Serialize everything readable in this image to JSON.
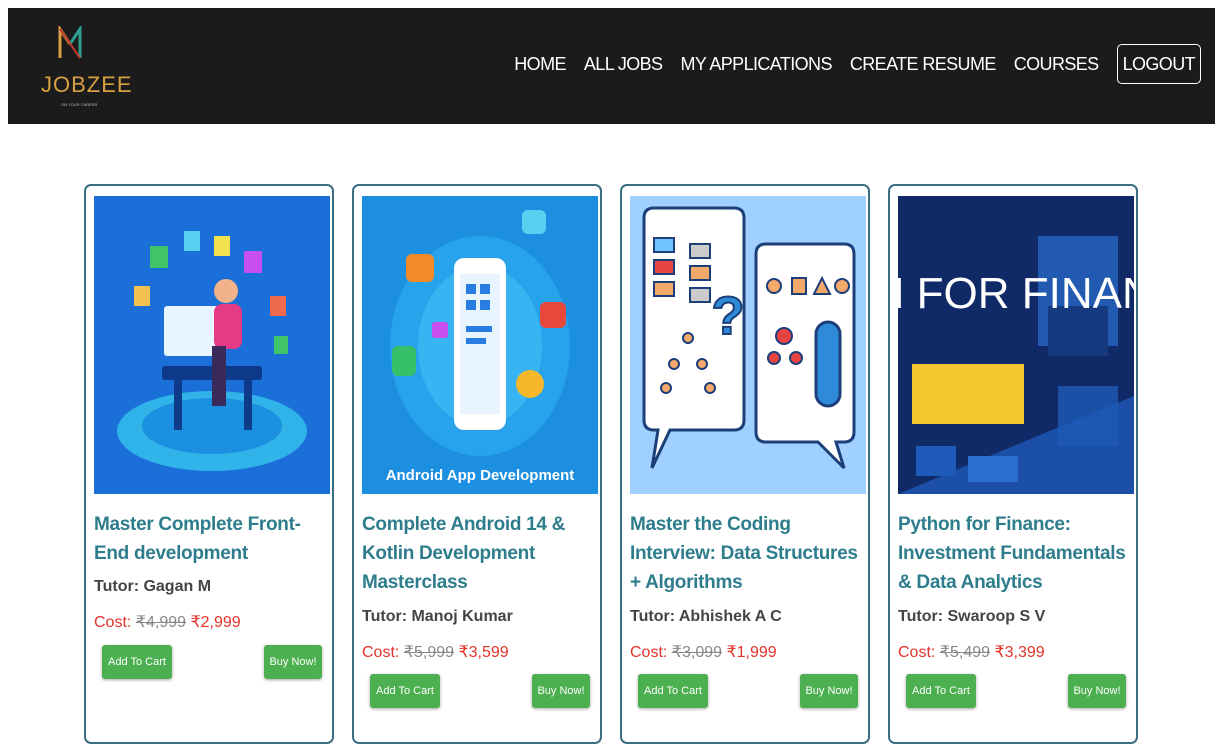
{
  "brand": {
    "name": "JOBZEE",
    "tagline": "ON YOUR CAREER"
  },
  "nav": {
    "items": [
      "HOME",
      "ALL JOBS",
      "MY APPLICATIONS",
      "CREATE RESUME",
      "COURSES"
    ],
    "logout": "LOGOUT"
  },
  "colors": {
    "navbar": "#1b1b1b",
    "title": "#2e7d8c",
    "price": "#e5332a",
    "button": "#4caf50",
    "card_border": "#3a6f82"
  },
  "courses": [
    {
      "title": "Master Complete Front-End development",
      "tutor": "Tutor: Gagan M",
      "cost_label": "Cost:",
      "original_price": "₹4,999",
      "price": "₹2,999",
      "add_to_cart": "Add To Cart",
      "buy_now": "Buy Now!",
      "image_text": ""
    },
    {
      "title": "Complete Android 14 & Kotlin Development Masterclass",
      "tutor": "Tutor: Manoj Kumar",
      "cost_label": "Cost:",
      "original_price": "₹5,999",
      "price": "₹3,599",
      "add_to_cart": "Add To Cart",
      "buy_now": "Buy Now!",
      "image_text": "Android App Development"
    },
    {
      "title": "Master the Coding Interview: Data Structures + Algorithms",
      "tutor": "Tutor: Abhishek A C",
      "cost_label": "Cost:",
      "original_price": "₹3,099",
      "price": "₹1,999",
      "add_to_cart": "Add To Cart",
      "buy_now": "Buy Now!",
      "image_text": ""
    },
    {
      "title": "Python for Finance: Investment Fundamentals & Data Analytics",
      "tutor": "Tutor: Swaroop S V",
      "cost_label": "Cost:",
      "original_price": "₹5,499",
      "price": "₹3,399",
      "add_to_cart": "Add To Cart",
      "buy_now": "Buy Now!",
      "image_text": "PYTHON FOR FINANCE"
    }
  ]
}
